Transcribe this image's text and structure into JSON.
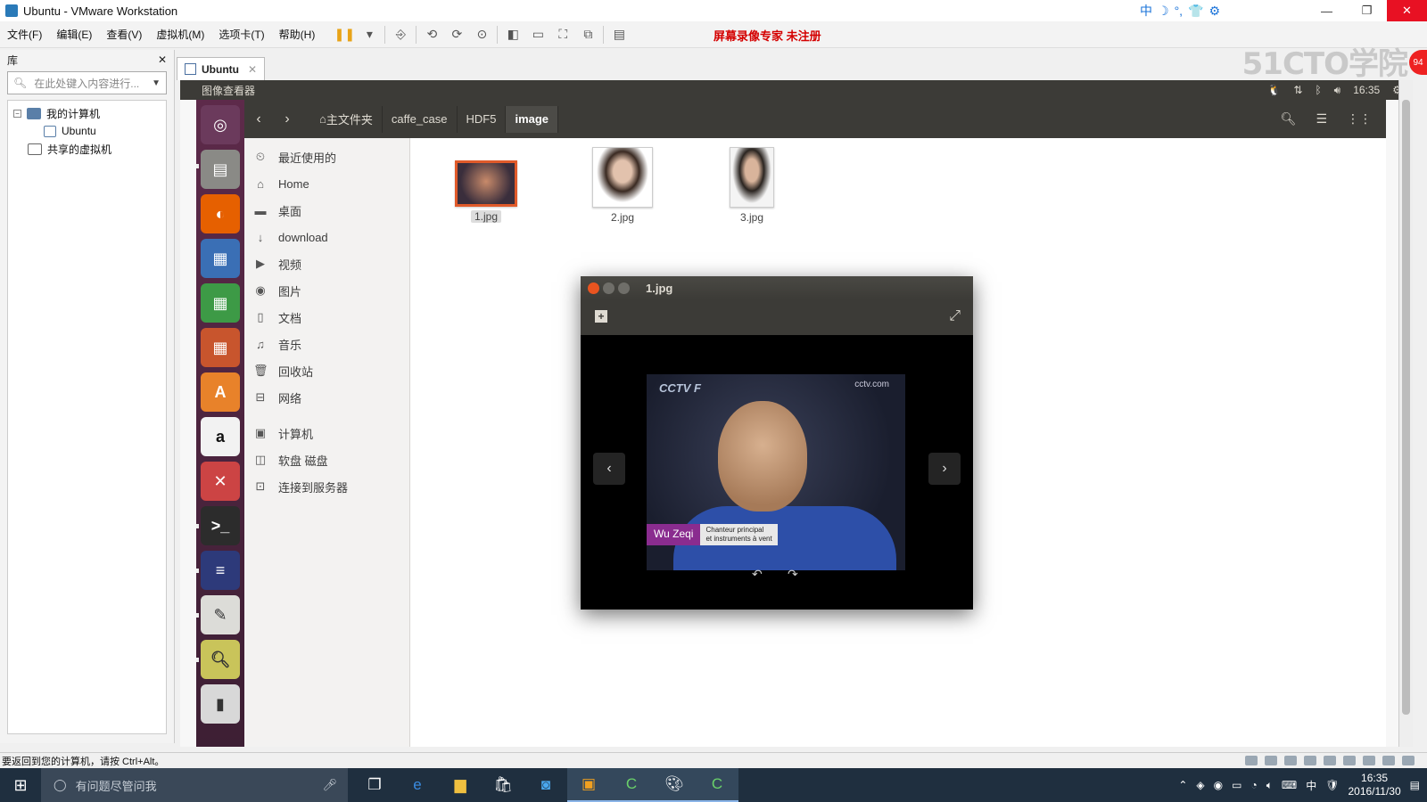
{
  "window": {
    "title": "Ubuntu - VMware Workstation",
    "controls": [
      "—",
      "❐",
      "✕"
    ]
  },
  "ime": [
    "中",
    "☽",
    "°,",
    "👕",
    "⚙"
  ],
  "menu": [
    "文件(F)",
    "编辑(E)",
    "查看(V)",
    "虚拟机(M)",
    "选项卡(T)",
    "帮助(H)"
  ],
  "recorder_text": "屏幕录像专家  未注册",
  "watermark": "51CTO学院",
  "badge": "94",
  "library": {
    "title": "库",
    "close": "✕",
    "search_placeholder": "在此处键入内容进行...",
    "tree": {
      "my_computer": "我的计算机",
      "vm": "Ubuntu",
      "shared": "共享的虚拟机"
    }
  },
  "tab": {
    "label": "Ubuntu",
    "close": "✕"
  },
  "ubuntu": {
    "app_title": "图像查看器",
    "clock": "16:35",
    "breadcrumbs": [
      "主文件夹",
      "caffe_case",
      "HDF5",
      "image"
    ],
    "places": [
      {
        "icon": "⏲",
        "label": "最近使用的"
      },
      {
        "icon": "⌂",
        "label": "Home"
      },
      {
        "icon": "▬",
        "label": "桌面"
      },
      {
        "icon": "↓",
        "label": "download"
      },
      {
        "icon": "▶",
        "label": "视频"
      },
      {
        "icon": "◉",
        "label": "图片"
      },
      {
        "icon": "▯",
        "label": "文档"
      },
      {
        "icon": "♫",
        "label": "音乐"
      },
      {
        "icon": "🗑",
        "label": "回收站"
      },
      {
        "icon": "⊟",
        "label": "网络"
      },
      {
        "icon": "▣",
        "label": "计算机"
      },
      {
        "icon": "◫",
        "label": "软盘 磁盘"
      },
      {
        "icon": "⊡",
        "label": "连接到服务器"
      }
    ],
    "files": [
      "1.jpg",
      "2.jpg",
      "3.jpg"
    ]
  },
  "viewer": {
    "title": "1.jpg",
    "photo_logo": "CCTV F",
    "photo_site": "cctv.com",
    "caption_name": "Wu Zeqi",
    "caption_desc_1": "Chanteur principal",
    "caption_desc_2": "et instruments à vent"
  },
  "status": "要返回到您的计算机，请按 Ctrl+Alt。",
  "taskbar": {
    "search_placeholder": "有问题尽管问我",
    "time": "16:35",
    "date": "2016/11/30",
    "ime": "中"
  }
}
